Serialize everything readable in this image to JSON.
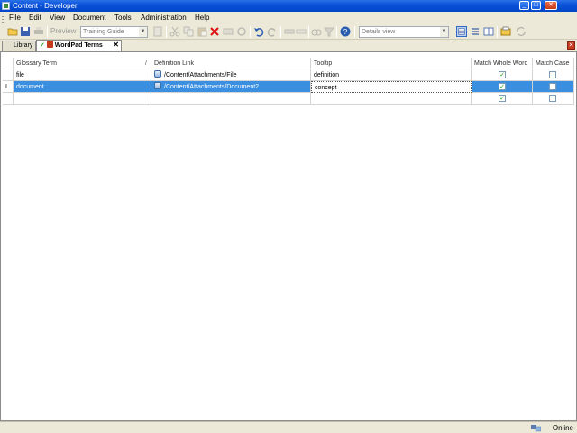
{
  "window": {
    "title": "Content - Developer",
    "buttons": {
      "minimize": "_",
      "maximize": "□",
      "close": "✕"
    }
  },
  "menu": [
    "File",
    "Edit",
    "View",
    "Document",
    "Tools",
    "Administration",
    "Help"
  ],
  "toolbar": {
    "preview_label": "Preview",
    "guide_combo": "Training Guide",
    "view_combo": "Details view",
    "icons": [
      "open-folder-icon",
      "save-icon",
      "print-icon",
      "cut-icon",
      "copy-icon",
      "paste-icon",
      "delete-icon",
      "undo-icon",
      "redo-icon",
      "find-icon",
      "help-icon",
      "details-view-icon",
      "list-view-icon",
      "columns-view-icon",
      "properties-icon",
      "refresh-icon"
    ]
  },
  "tabs": [
    {
      "label": "Library",
      "active": false
    },
    {
      "label": "WordPad Terms",
      "active": true
    }
  ],
  "grid": {
    "columns": [
      "Glossary Term",
      "Definition Link",
      "Tooltip",
      "Match Whole Word",
      "Match Case"
    ],
    "sort_indicator": "/",
    "rows": [
      {
        "term": "file",
        "link": "/Content/Attachments/File",
        "tooltip": "definition",
        "match_whole_word": true,
        "match_case": false,
        "selected": false
      },
      {
        "term": "document",
        "link": "/Content/Attachments/Document2",
        "tooltip": "concept",
        "match_whole_word": true,
        "match_case": false,
        "selected": true,
        "row_marker": "I"
      },
      {
        "term": "",
        "link": "",
        "tooltip": "",
        "match_whole_word": true,
        "match_case": false,
        "selected": false
      }
    ]
  },
  "status": {
    "text": "Online"
  },
  "colors": {
    "titlebar": "#0a52d8",
    "selection": "#3a8fe0",
    "check": "#21a121"
  }
}
